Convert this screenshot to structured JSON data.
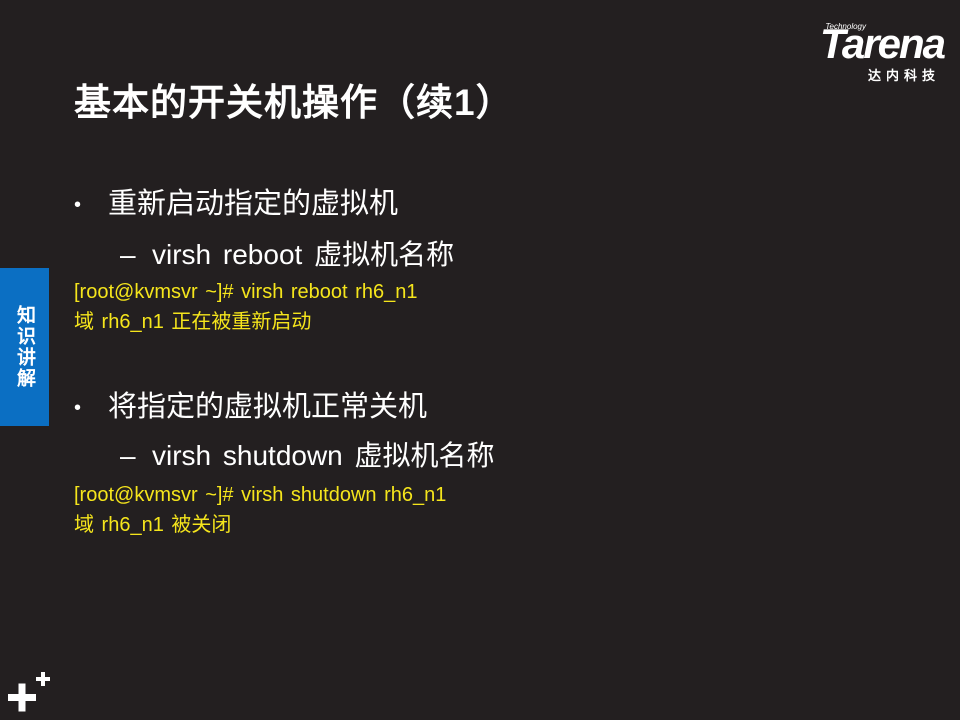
{
  "slide": {
    "title": "基本的开关机操作（续1）"
  },
  "logo": {
    "technology": "Technology",
    "wordmark": "Tarena",
    "subtitle": "达内科技"
  },
  "side_tab": {
    "label": "知识讲解"
  },
  "section1": {
    "bullet": "重新启动指定的虚拟机",
    "sub": "virsh  reboot  虚拟机名称",
    "code_line1": "[root@kvmsvr ~]# virsh  reboot  rh6_n1",
    "code_line2": "域 rh6_n1 正在被重新启动"
  },
  "section2": {
    "bullet": "将指定的虚拟机正常关机",
    "sub": "virsh  shutdown  虚拟机名称",
    "code_line1": "[root@kvmsvr ~]# virsh  shutdown  rh6_n1",
    "code_line2": "域 rh6_n1 被关闭"
  },
  "symbols": {
    "bullet": "•",
    "dash": "–"
  },
  "colors": {
    "background": "#231f20",
    "code_text": "#f5e51c",
    "side_tab": "#0b6fc3",
    "text": "#ffffff"
  }
}
